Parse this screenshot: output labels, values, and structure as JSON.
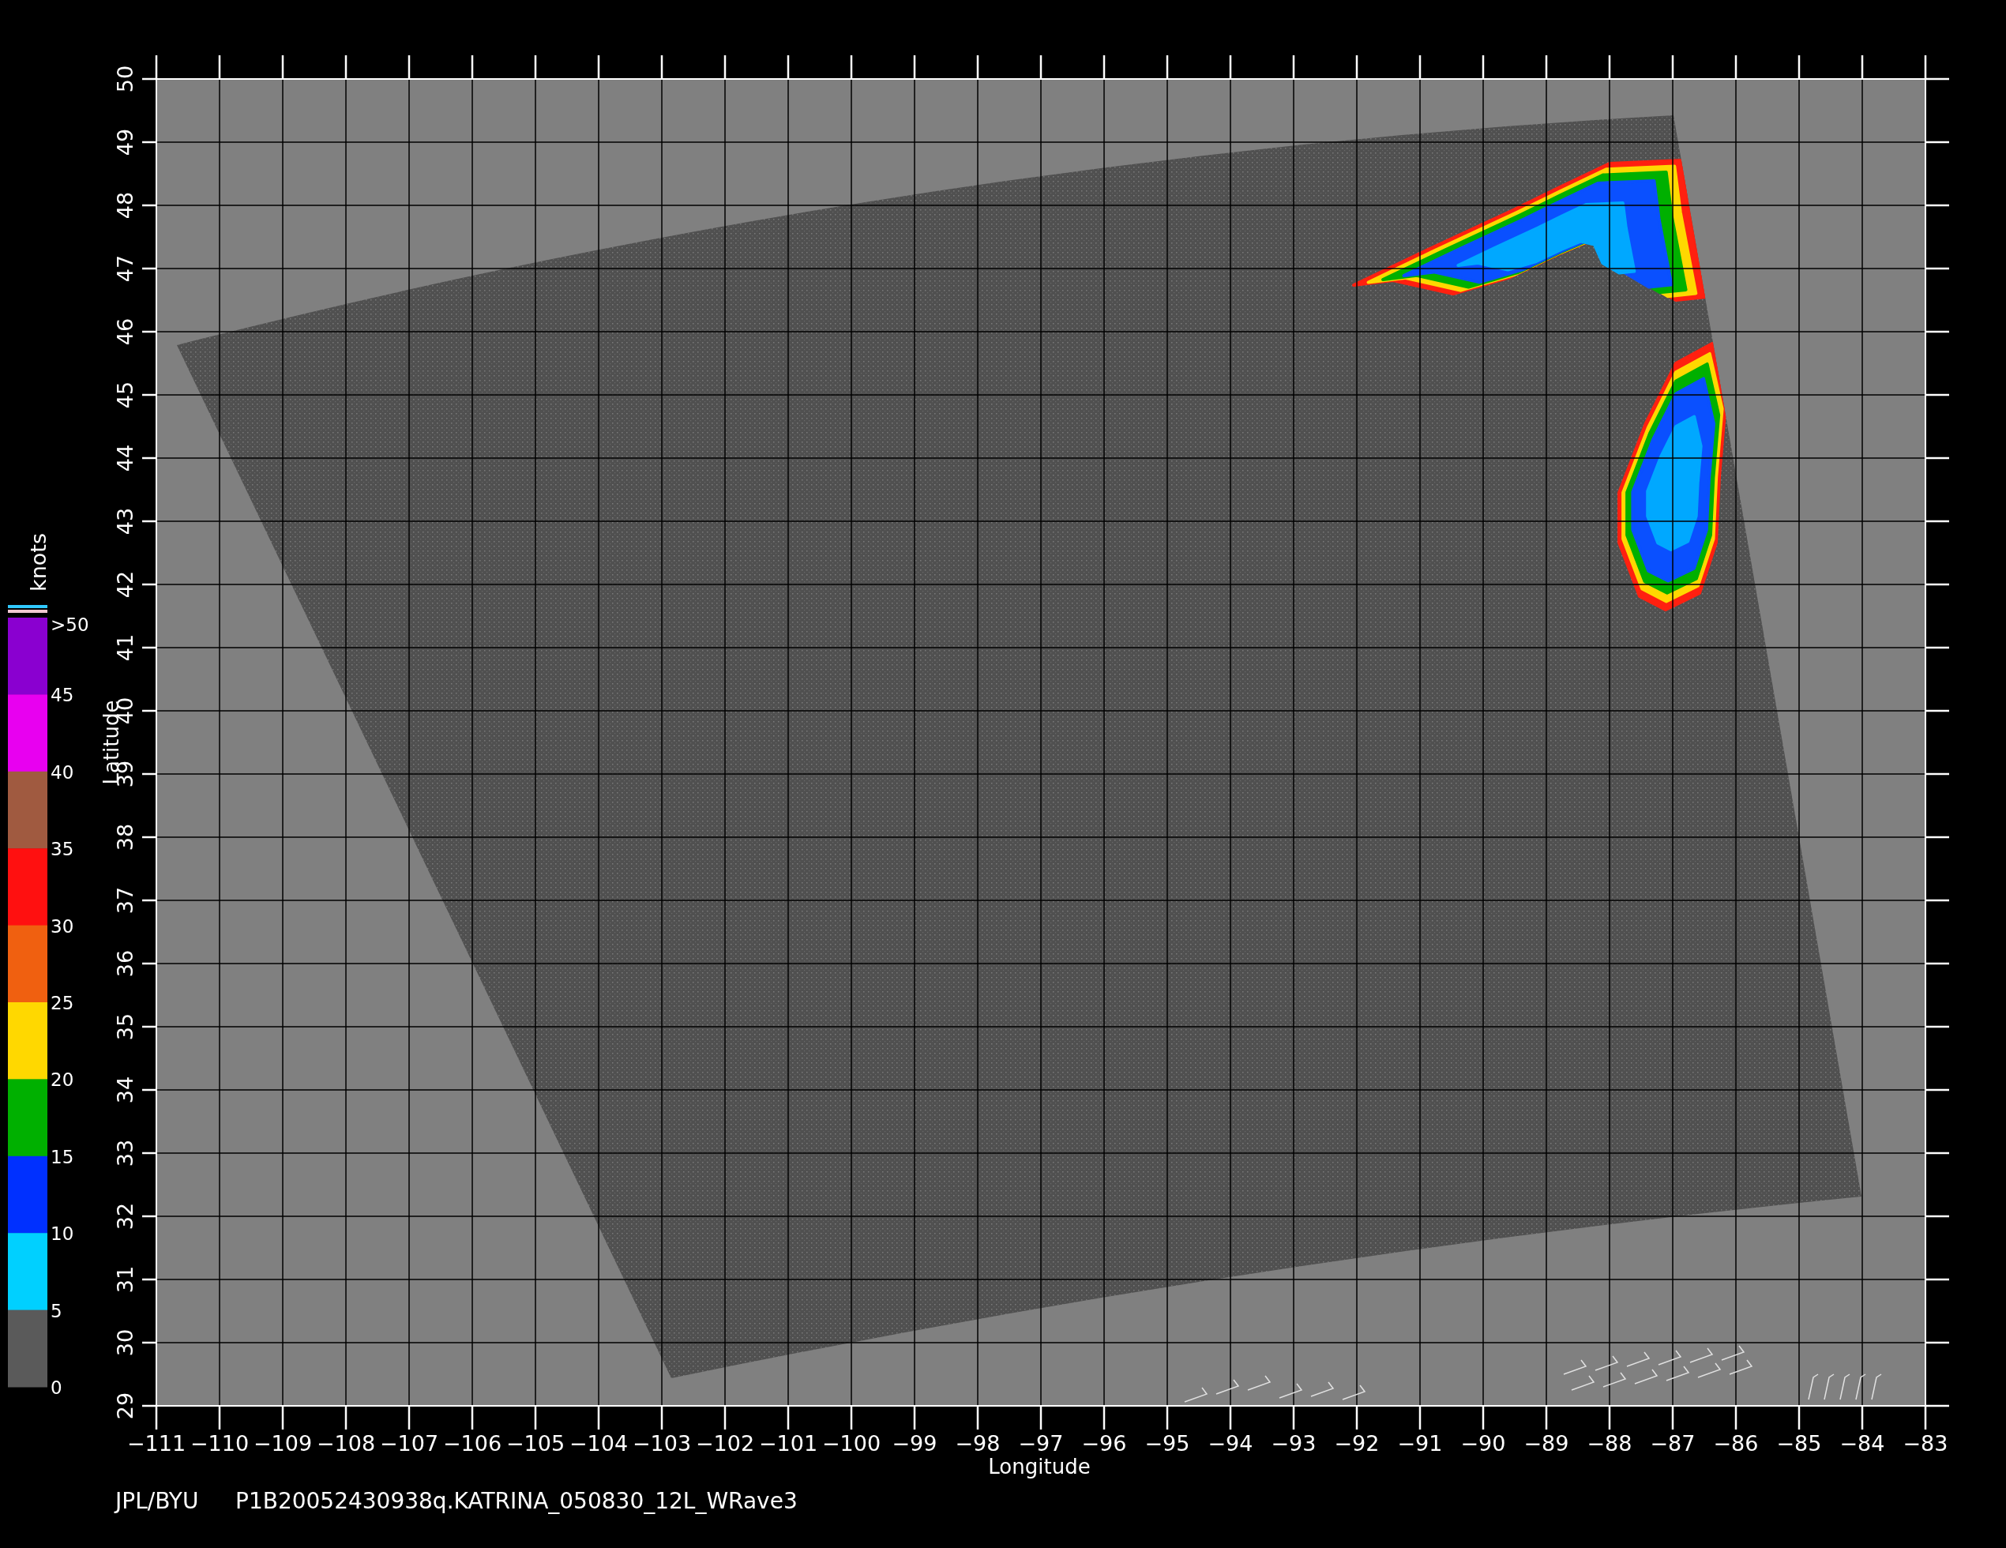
{
  "plot": {
    "x_ticks": [
      "−111",
      "−110",
      "−109",
      "−108",
      "−107",
      "−106",
      "−105",
      "−104",
      "−103",
      "−102",
      "−101",
      "−100",
      "−99",
      "−98",
      "−97",
      "−96",
      "−95",
      "−94",
      "−93",
      "−92",
      "−91",
      "−90",
      "−89",
      "−88",
      "−87",
      "−86",
      "−85",
      "−84",
      "−83"
    ],
    "y_ticks": [
      "29",
      "30",
      "31",
      "32",
      "33",
      "34",
      "35",
      "36",
      "37",
      "38",
      "39",
      "40",
      "41",
      "42",
      "43",
      "44",
      "45",
      "46",
      "47",
      "48",
      "49",
      "50"
    ],
    "xlabel": "Longitude",
    "ylabel": "Latitude"
  },
  "colorbar": {
    "unit": "knots",
    "bands": [
      {
        "color": "#8a00d0"
      },
      {
        "color": "#e800f0"
      },
      {
        "color": "#a05a40"
      },
      {
        "color": "#ff1010"
      },
      {
        "color": "#f06010"
      },
      {
        "color": "#ffd800"
      },
      {
        "color": "#00b000"
      },
      {
        "color": "#0030ff"
      },
      {
        "color": "#00d0ff"
      },
      {
        "color": "#5a5a5a"
      }
    ],
    "labels": [
      ">50",
      "45",
      "40",
      "35",
      "30",
      "25",
      "20",
      "15",
      "10",
      "5",
      "0"
    ]
  },
  "caption": {
    "source": "JPL/BYU",
    "file": "P1B20052430938q.KATRINA_050830_12L_WRave3"
  }
}
